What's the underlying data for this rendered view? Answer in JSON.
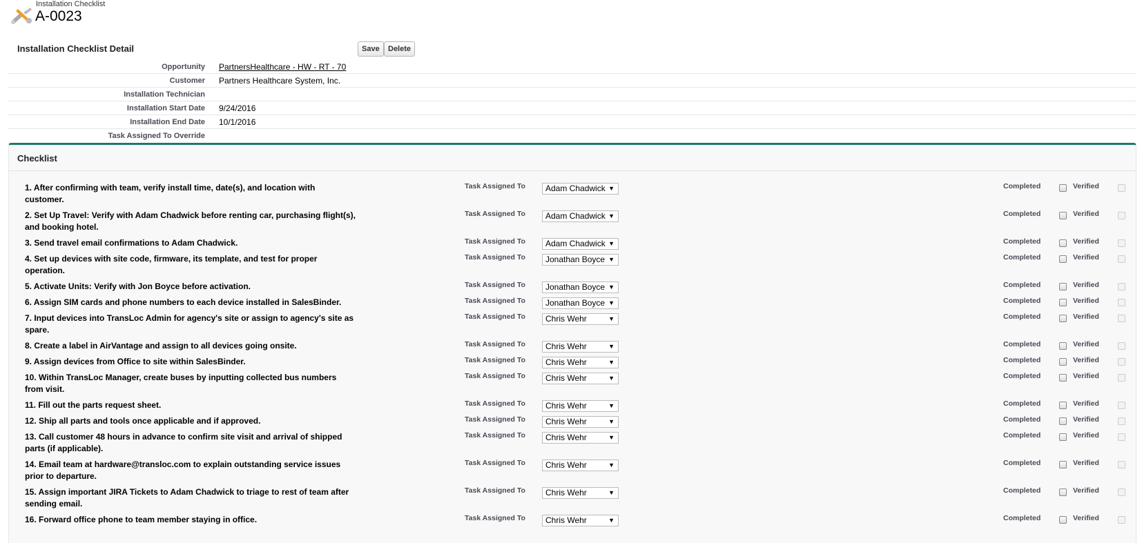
{
  "header": {
    "object_type": "Installation Checklist",
    "record_name": "A-0023",
    "icon": "tools-icon"
  },
  "detail": {
    "title": "Installation Checklist Detail",
    "save_label": "Save",
    "delete_label": "Delete",
    "fields": [
      {
        "label": "Opportunity",
        "value": "PartnersHealthcare - HW - RT - 70",
        "link": true
      },
      {
        "label": "Customer",
        "value": "Partners Healthcare System, Inc."
      },
      {
        "label": "Installation Technician",
        "value": ""
      },
      {
        "label": "Installation Start Date",
        "value": "9/24/2016"
      },
      {
        "label": "Installation End Date",
        "value": "10/1/2016"
      },
      {
        "label": "Task Assigned To Override",
        "value": ""
      }
    ]
  },
  "checklist": {
    "title": "Checklist",
    "assigned_label": "Task Assigned To",
    "completed_label": "Completed",
    "verified_label": "Verified",
    "items": [
      {
        "text": "1. After confirming with team, verify install time, date(s), and location with customer.",
        "assignee": "Adam Chadwick"
      },
      {
        "text": "2. Set Up Travel: Verify with Adam Chadwick before renting car, purchasing flight(s), and booking hotel.",
        "assignee": "Adam Chadwick"
      },
      {
        "text": "3. Send travel email confirmations to Adam Chadwick.",
        "assignee": "Adam Chadwick"
      },
      {
        "text": "4. Set up devices with site code, firmware, its template, and test for proper operation.",
        "assignee": "Jonathan Boyce"
      },
      {
        "text": "5. Activate Units: Verify with Jon Boyce before activation.",
        "assignee": "Jonathan Boyce"
      },
      {
        "text": "6. Assign SIM cards and phone numbers to each device installed in SalesBinder.",
        "assignee": "Jonathan Boyce"
      },
      {
        "text": "7. Input devices into TransLoc Admin for agency's site or assign to agency's site as spare.",
        "assignee": "Chris Wehr"
      },
      {
        "text": "8. Create a label in AirVantage and assign to all devices going onsite.",
        "assignee": "Chris Wehr"
      },
      {
        "text": "9. Assign devices from Office to site within SalesBinder.",
        "assignee": "Chris Wehr"
      },
      {
        "text": "10. Within TransLoc Manager, create buses by inputting collected bus numbers from visit.",
        "assignee": "Chris Wehr"
      },
      {
        "text": "11. Fill out the parts request sheet.",
        "assignee": "Chris Wehr"
      },
      {
        "text": "12. Ship all parts and tools once applicable and if approved.",
        "assignee": "Chris Wehr"
      },
      {
        "text": "13. Call customer 48 hours in advance to confirm site visit and arrival of shipped parts (if applicable).",
        "assignee": "Chris Wehr"
      },
      {
        "text": "14. Email team at hardware@transloc.com to explain outstanding service issues prior to departure.",
        "assignee": "Chris Wehr"
      },
      {
        "text": "15. Assign important JIRA Tickets to Adam Chadwick to triage to rest of team after sending email.",
        "assignee": "Chris Wehr"
      },
      {
        "text": "16. Forward office phone to team member staying in office.",
        "assignee": "Chris Wehr"
      }
    ]
  }
}
